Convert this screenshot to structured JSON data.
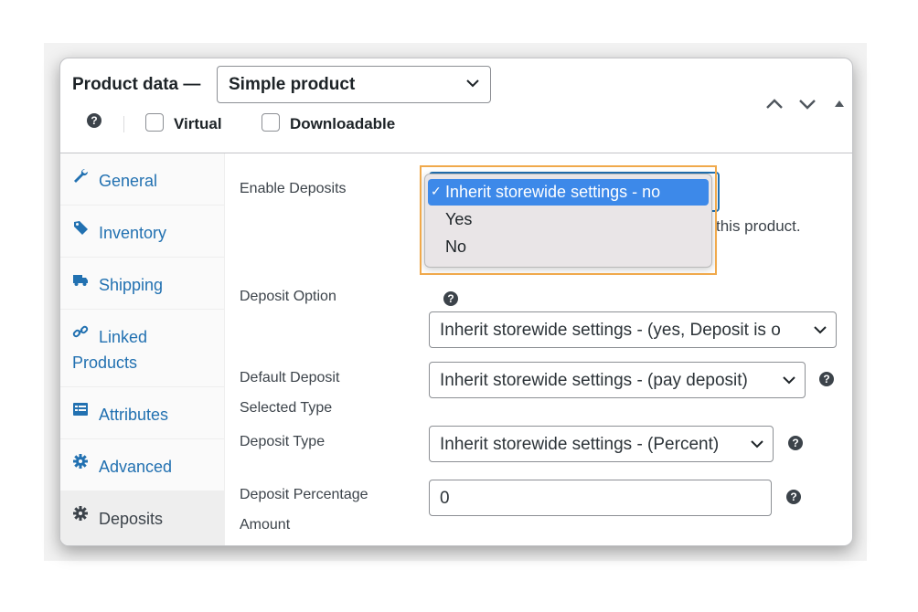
{
  "header": {
    "title": "Product data —",
    "product_type": "Simple product",
    "virtual_label": "Virtual",
    "downloadable_label": "Downloadable",
    "help_icon": "help-icon",
    "controls": [
      "move-up-icon",
      "move-down-icon",
      "toggle-panel-icon"
    ]
  },
  "tabs": [
    {
      "label": "General",
      "icon": "wrench-icon"
    },
    {
      "label": "Inventory",
      "icon": "tag-icon"
    },
    {
      "label": "Shipping",
      "icon": "truck-icon"
    },
    {
      "label": "Linked",
      "label2": "Products",
      "icon": "link-icon"
    },
    {
      "label": "Attributes",
      "icon": "list-icon"
    },
    {
      "label": "Advanced",
      "icon": "gear-icon"
    },
    {
      "label": "Deposits",
      "icon": "gear-icon",
      "active": true
    }
  ],
  "fields": {
    "enable_deposits": {
      "label": "Enable Deposits",
      "options": [
        "Inherit storewide settings - no",
        "Yes",
        "No"
      ],
      "selected": "Inherit storewide settings - no",
      "check": "✓",
      "description_visible": "this product."
    },
    "deposit_option": {
      "label": "Deposit Option",
      "value": "Inherit storewide settings - (yes, Deposit is o"
    },
    "default_deposit_type": {
      "label1": "Default Deposit",
      "label2": "Selected Type",
      "value": "Inherit storewide settings - (pay deposit)"
    },
    "deposit_type": {
      "label": "Deposit Type",
      "value": "Inherit storewide settings - (Percent)"
    },
    "deposit_percentage": {
      "label1": "Deposit Percentage",
      "label2": "Amount",
      "value": "0"
    }
  },
  "colors": {
    "link": "#2271b1",
    "highlight": "#3d89e9",
    "annotation_border": "#f0a94b"
  }
}
